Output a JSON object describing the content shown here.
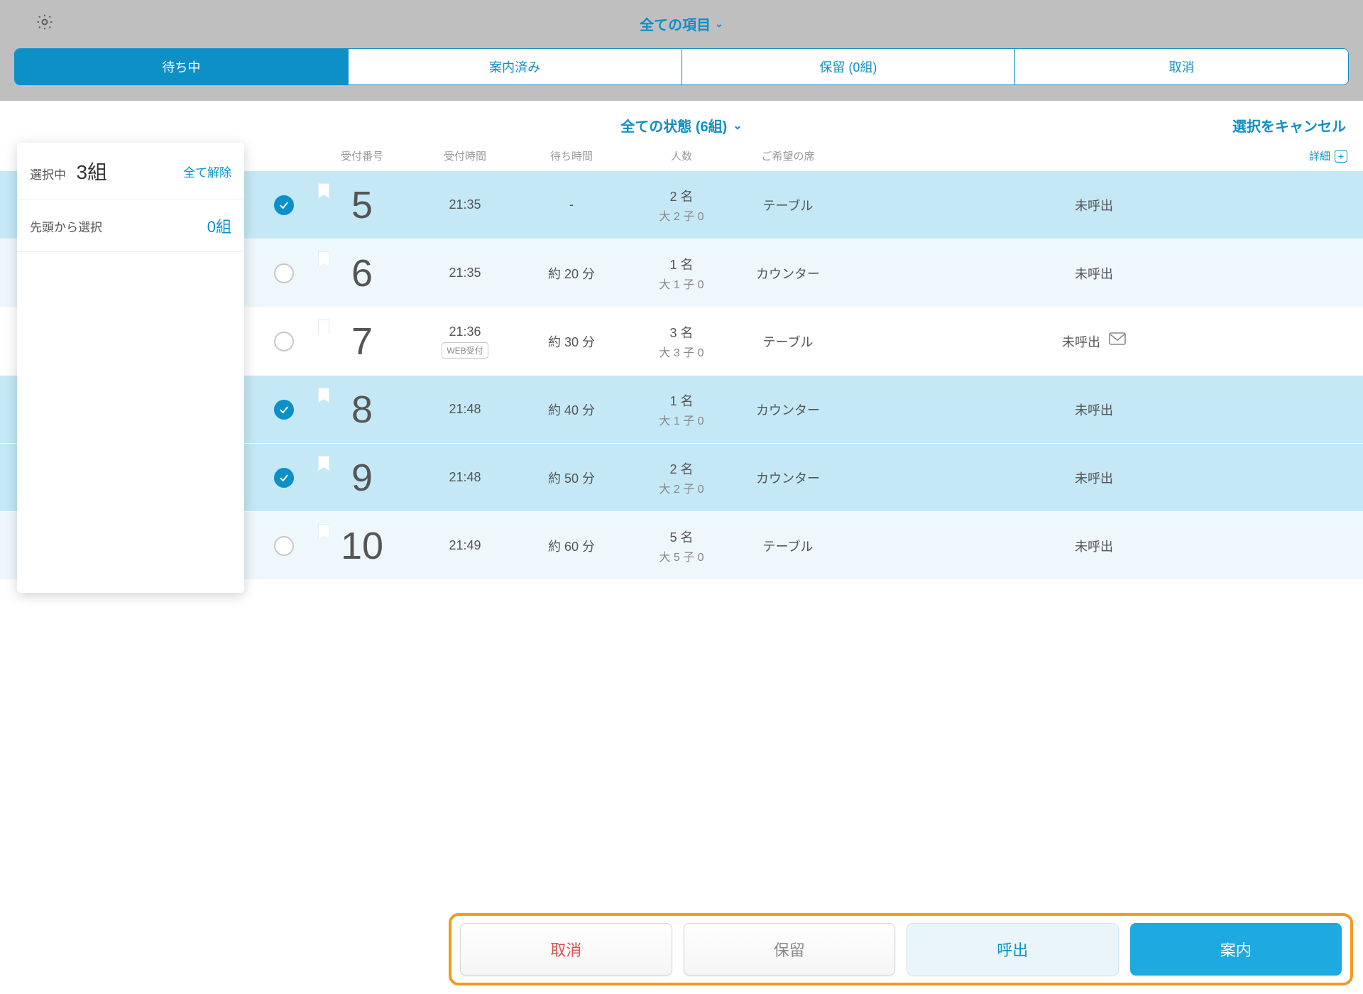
{
  "topbar": {
    "title": "全ての項目"
  },
  "tabs": {
    "waiting": "待ち中",
    "guided": "案内済み",
    "hold": "保留 (0組)",
    "cancel": "取消"
  },
  "subheader": {
    "center": "全ての状態 (6組)",
    "cancel_selection": "選択をキャンセル"
  },
  "columns": {
    "number": "受付番号",
    "time": "受付時間",
    "wait": "待ち時間",
    "people": "人数",
    "seat": "ご希望の席",
    "detail": "詳細"
  },
  "side": {
    "selecting_label": "選択中",
    "selecting_count": "3組",
    "clear_all": "全て解除",
    "from_top_label": "先頭から選択",
    "from_top_count": "0組"
  },
  "rows": [
    {
      "selected": true,
      "num": "5",
      "time": "21:35",
      "web": false,
      "wait": "-",
      "people_main": "2 名",
      "people_sub": "大 2 子 0",
      "seat": "テーブル",
      "status": "未呼出",
      "mail": false,
      "alt": false
    },
    {
      "selected": false,
      "num": "6",
      "time": "21:35",
      "web": false,
      "wait": "約 20 分",
      "people_main": "1 名",
      "people_sub": "大 1 子 0",
      "seat": "カウンター",
      "status": "未呼出",
      "mail": false,
      "alt": true
    },
    {
      "selected": false,
      "num": "7",
      "time": "21:36",
      "web": true,
      "wait": "約 30 分",
      "people_main": "3 名",
      "people_sub": "大 3 子 0",
      "seat": "テーブル",
      "status": "未呼出",
      "mail": true,
      "alt": false
    },
    {
      "selected": true,
      "num": "8",
      "time": "21:48",
      "web": false,
      "wait": "約 40 分",
      "people_main": "1 名",
      "people_sub": "大 1 子 0",
      "seat": "カウンター",
      "status": "未呼出",
      "mail": false,
      "alt": true
    },
    {
      "selected": true,
      "num": "9",
      "time": "21:48",
      "web": false,
      "wait": "約 50 分",
      "people_main": "2 名",
      "people_sub": "大 2 子 0",
      "seat": "カウンター",
      "status": "未呼出",
      "mail": false,
      "alt": false
    },
    {
      "selected": false,
      "num": "10",
      "time": "21:49",
      "web": false,
      "wait": "約 60 分",
      "people_main": "5 名",
      "people_sub": "大 5 子 0",
      "seat": "テーブル",
      "status": "未呼出",
      "mail": false,
      "alt": true
    }
  ],
  "web_badge": "WEB受付",
  "actions": {
    "cancel": "取消",
    "hold": "保留",
    "call": "呼出",
    "guide": "案内"
  }
}
